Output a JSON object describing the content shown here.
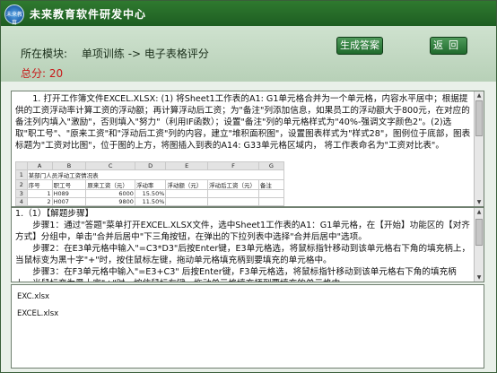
{
  "app": {
    "title": "未来教育软件研发中心",
    "logo_text": "未来教育"
  },
  "header": {
    "module_label": "所在模块:",
    "module_value": "单项训练 -> 电子表格评分",
    "score": "总分: 20",
    "generate_button": "生成答案",
    "back_button": "返回"
  },
  "question": {
    "text": "1. 打开工作簿文件EXCEL.XLSX: (1) 将Sheet1工作表的A1: G1单元格合并为一个单元格，内容水平居中；根据提供的工资浮动率计算工资的浮动额；再计算浮动后工资；为\"备注\"列添加信息，如果员工的浮动额大于800元，在对应的备注列内填入\"激励\"，否则填入\"努力\"（利用IF函数）；设置\"备注\"列的单元格样式为\"40%-强调文字颜色2\"。(2)选取\"职工号\"、\"原来工资\"和\"浮动后工资\"列的内容，建立\"堆积面积图\"，设置图表样式为\"样式28\"，图例位于底部，图表标题为\"工资对比图\"，位于图的上方，将图插入到表的A14: G33单元格区域内， 将工作表命名为\"工资对比表\"。",
    "sheet": {
      "col_headers": [
        "",
        "A",
        "B",
        "C",
        "D",
        "E",
        "F",
        "G"
      ],
      "rows": [
        [
          "1",
          "某部门人员浮动工资情况表",
          "",
          "",
          "",
          "",
          "",
          ""
        ],
        [
          "2",
          "序号",
          "职工号",
          "原来工资（元）",
          "浮动率",
          "浮动额（元）",
          "浮动后工资（元）",
          "备注"
        ],
        [
          "3",
          "1",
          "H089",
          "6000",
          "15.50%",
          "",
          "",
          ""
        ],
        [
          "4",
          "2",
          "H007",
          "9800",
          "11.50%",
          "",
          "",
          ""
        ]
      ]
    }
  },
  "answer": {
    "heading": "1.（1）【解题步骤】",
    "steps": [
      "步骤1：通过\"答题\"菜单打开EXCEL.XLSX文件，选中Sheet1工作表的A1：G1单元格，在【开始】功能区的【对齐方式】分组中，单击\"合并后居中\"下三角按钮，在弹出的下拉列表中选择\"合并后居中\"选项。",
      "步骤2：在E3单元格中输入\"=C3*D3\"后按Enter键，E3单元格选，将鼠标指针移动到该单元格右下角的填充柄上，当鼠标变为黑十字\"+\"时，按住鼠标左键，拖动单元格填充柄到要填充的单元格中。",
      "步骤3：在F3单元格中输入\"=E3+C3\" 后按Enter键，F3单元格选，将鼠标指针移动到该单元格右下角的填充柄上，当鼠标变为黑十字\"+\"时，按住鼠标左键，拖动单元格填充柄到要填充的单元格中。"
    ]
  },
  "files": [
    "EXC.xlsx",
    "EXCEL.xlsx"
  ]
}
